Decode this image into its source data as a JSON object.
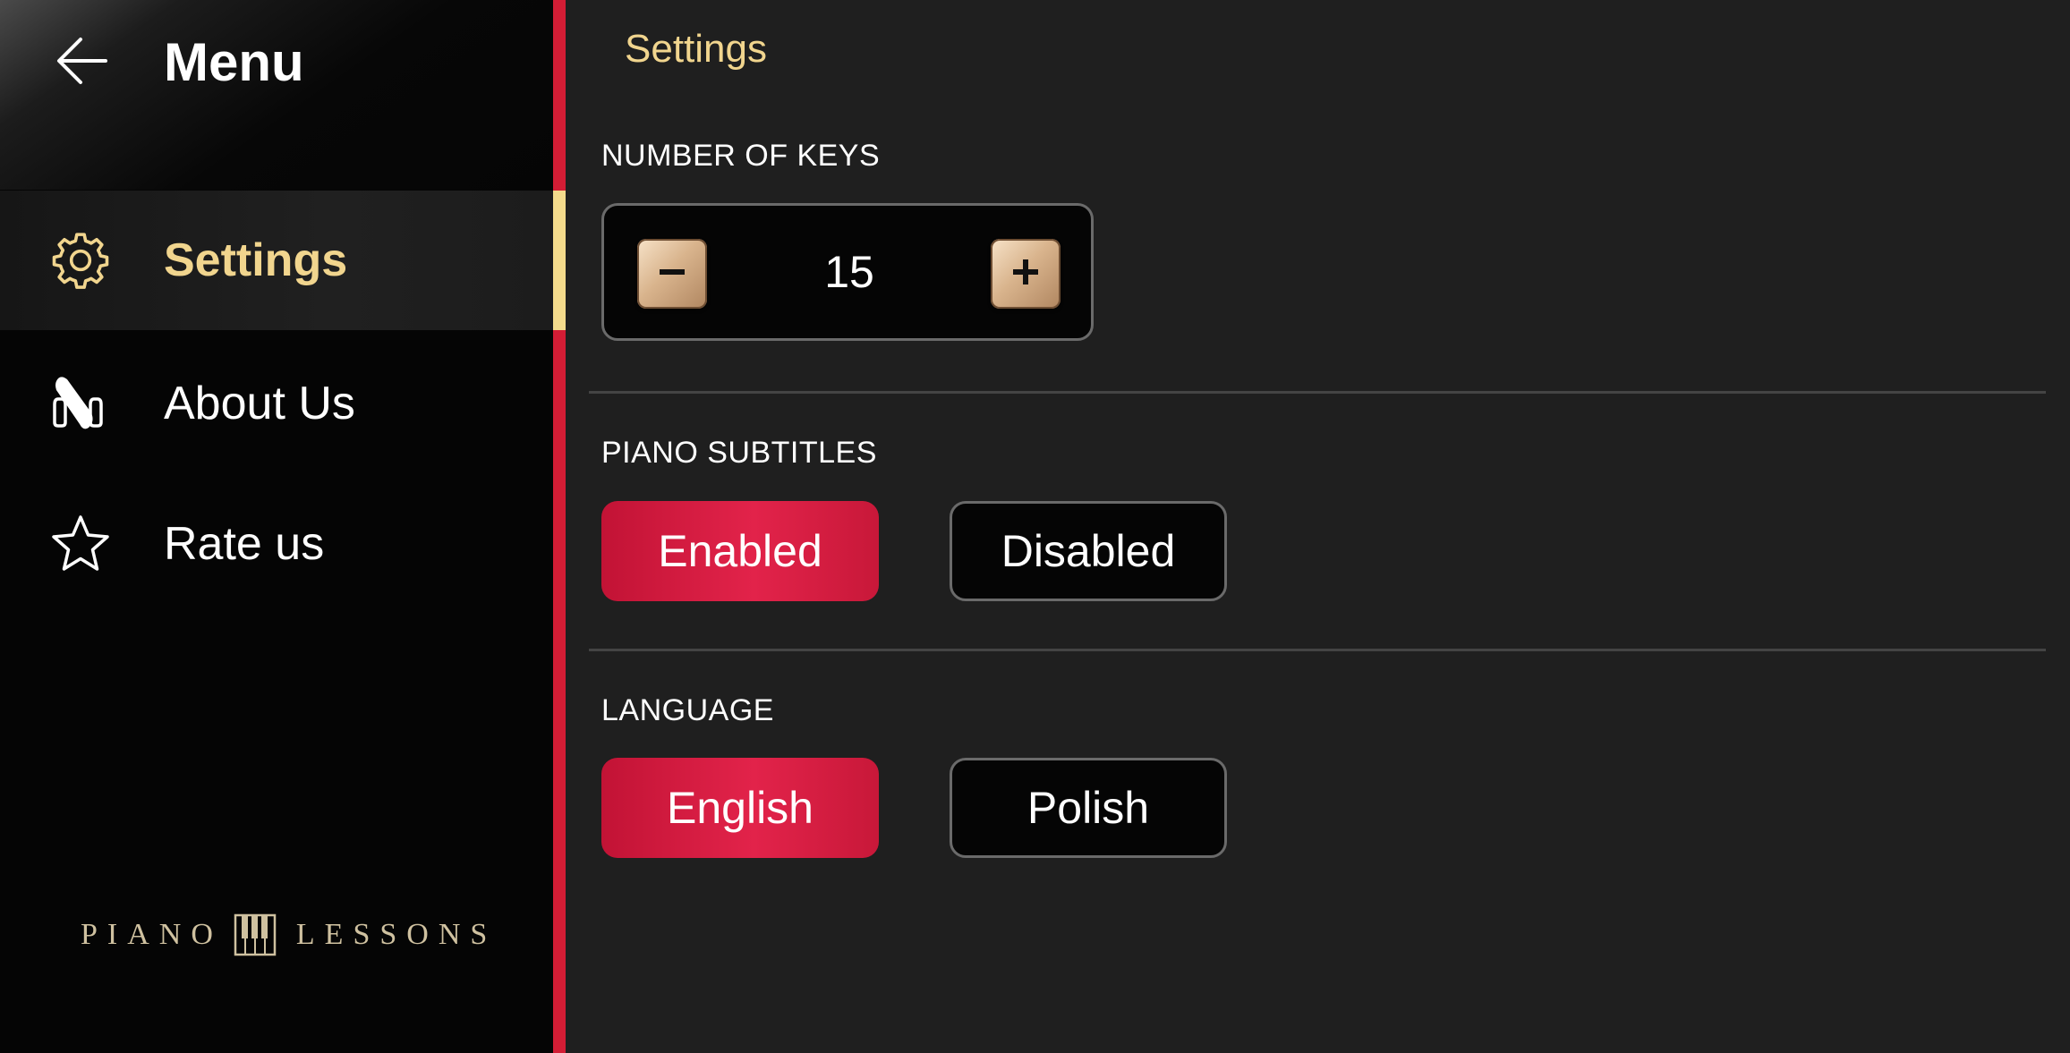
{
  "sidebar": {
    "title": "Menu",
    "back_icon": "arrow-left-icon",
    "items": [
      {
        "label": "Settings",
        "icon": "gear-icon",
        "active": true
      },
      {
        "label": "About Us",
        "icon": "piano-pedals-icon",
        "active": false
      },
      {
        "label": "Rate us",
        "icon": "star-icon",
        "active": false
      }
    ],
    "brand": {
      "left": "PIANO",
      "right": "LESSONS",
      "icon": "piano-keys-icon"
    }
  },
  "main": {
    "title": "Settings",
    "number_of_keys": {
      "label": "NUMBER OF KEYS",
      "value": "15",
      "decrement_icon": "minus-icon",
      "increment_icon": "plus-icon"
    },
    "piano_subtitles": {
      "label": "PIANO SUBTITLES",
      "options": [
        "Enabled",
        "Disabled"
      ],
      "selected": "Enabled"
    },
    "language": {
      "label": "LANGUAGE",
      "options": [
        "English",
        "Polish"
      ],
      "selected": "English"
    }
  },
  "colors": {
    "accent_gold": "#f1d58e",
    "accent_red": "#d31d35",
    "background": "#1f1f1f",
    "sidebar": "#050505"
  }
}
